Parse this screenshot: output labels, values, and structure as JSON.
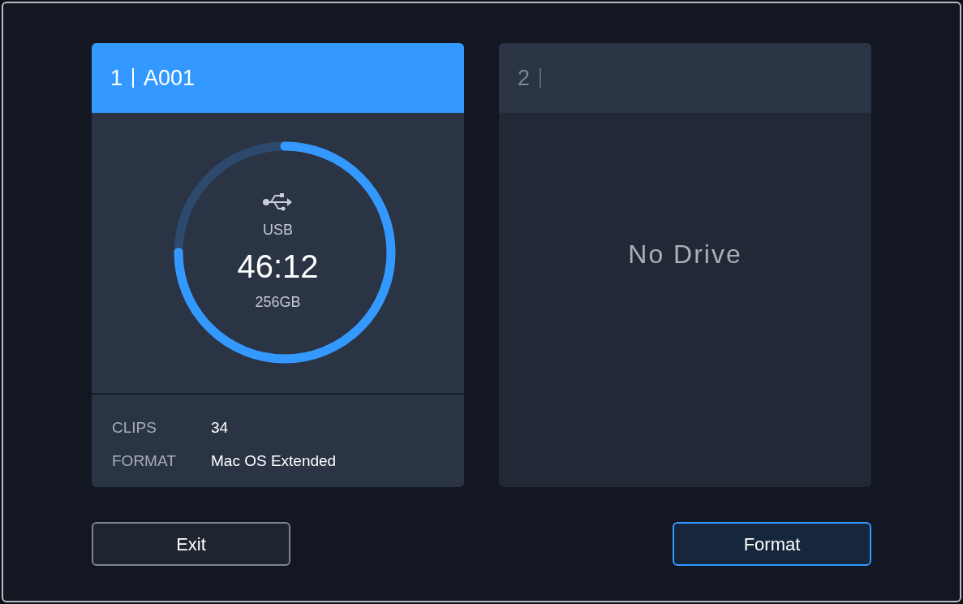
{
  "slots": [
    {
      "kind": "drive",
      "selected": true,
      "number": "1",
      "name": "A001",
      "media": "USB",
      "time": "46:12",
      "capacity": "256GB",
      "level": 0.75,
      "info": [
        {
          "label": "CLIPS",
          "value": "34"
        },
        {
          "label": "FORMAT",
          "value": "Mac OS Extended"
        }
      ]
    },
    {
      "kind": "empty",
      "selected": false,
      "number": "2",
      "message": "No Drive"
    }
  ],
  "buttons": [
    {
      "label": "Exit",
      "primary": false
    },
    {
      "label": "Format",
      "primary": true
    }
  ]
}
